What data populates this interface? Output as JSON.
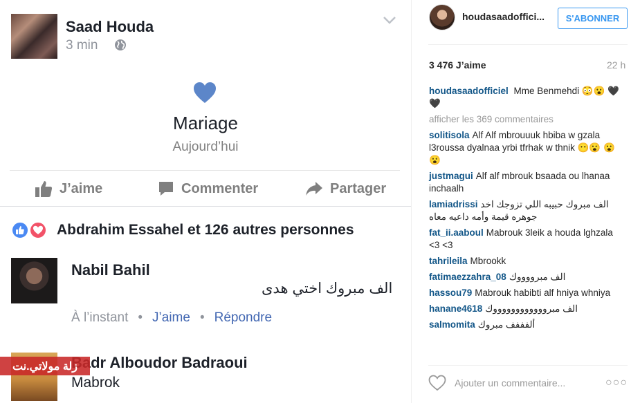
{
  "fb": {
    "author": "Saad Houda",
    "time": "3 min",
    "event_title": "Mariage",
    "event_sub": "Aujourd’hui",
    "actions": {
      "like": "J’aime",
      "comment": "Commenter",
      "share": "Partager"
    },
    "reactions_text": "Abdrahim Essahel et 126 autres personnes",
    "comment1": {
      "author": "Nabil Bahil",
      "text": "الف مبروك اختي هدى",
      "time": "À l’instant",
      "like": "J’aime",
      "reply": "Répondre"
    },
    "comment2": {
      "author": "Badr Alboudor Badraoui",
      "text": "Mabrok"
    },
    "watermark": "زلة مولاتي.نت"
  },
  "ig": {
    "username": "houdasaadoffici...",
    "follow": "S'ABONNER",
    "likes": "3 476 J’aime",
    "time": "22 h",
    "caption": {
      "user": "houdasaadofficiel",
      "text": "Mme Benmehdi 😳😮 🖤🖤"
    },
    "show_comments": "afficher les 369 commentaires",
    "comments": [
      {
        "user": "solitisola",
        "text": "Alf Alf mbrouuuk hbiba w gzala l3roussa dyalnaa yrbi tfrhak w thnik 😶😮 😮😮"
      },
      {
        "user": "justmagui",
        "text": "Alf alf mbrouk bsaada ou lhanaa inchaalh"
      },
      {
        "user": "lamiadrissi",
        "text": "الف مبروك حبيبه اللي تزوجك اخد جوهره قيمة وأمه داعيه معاه"
      },
      {
        "user": "fat_ii.aaboul",
        "text": "Mabrouk 3leik a houda lghzala <3 <3"
      },
      {
        "user": "tahrileila",
        "text": "Mbrookk"
      },
      {
        "user": "fatimaezzahra_08",
        "text": "الف مبرووووك"
      },
      {
        "user": "hassou79",
        "text": "Mabrouk habibti alf hniya whniya"
      },
      {
        "user": "hanane4618",
        "text": "الف مبرووووووووووووك"
      },
      {
        "user": "salmomita",
        "text": "ألفففف مبروك"
      }
    ],
    "add_comment": "Ajouter un commentaire...",
    "more": "○○○"
  },
  "colors": {
    "fb_blue": "#4267b2",
    "heart_blue": "#5c86c9",
    "ig_link": "#125688",
    "ig_follow": "#3897f0"
  }
}
